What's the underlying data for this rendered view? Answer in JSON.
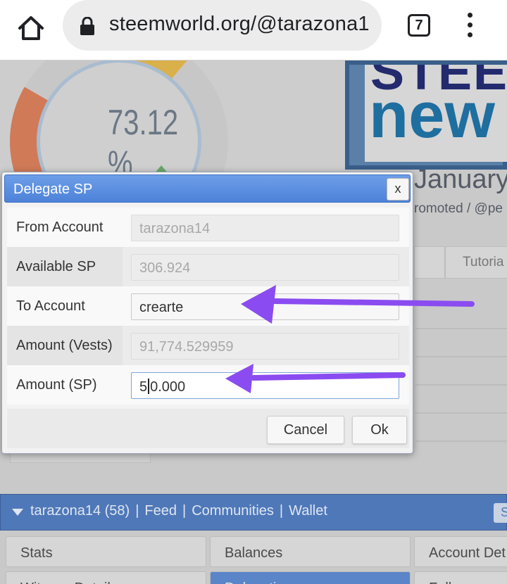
{
  "browser": {
    "url": "steemworld.org/@tarazona1",
    "tab_count": "7",
    "home_icon": "home-icon",
    "lock_icon": "lock-icon",
    "menu_icon": "more-vert-icon"
  },
  "background": {
    "gauge_value": "73.12 %",
    "banner_word_1": "STEE",
    "banner_word_2": "new",
    "banner_date": "January",
    "banner_promo": "romoted / @pe",
    "tutorial_tab": "Tutoria"
  },
  "nav": {
    "account": "tarazona14 (58)",
    "feed": "Feed",
    "communities": "Communities",
    "wallet": "Wallet",
    "sep": "|",
    "right_btn": "S",
    "buttons": {
      "stats": "Stats",
      "balances": "Balances",
      "account_details": "Account Det",
      "witness_details": "Witness Details",
      "delegations": "Delegations",
      "followers": "Followers"
    }
  },
  "dialog": {
    "title": "Delegate SP",
    "close_label": "x",
    "rows": [
      {
        "label": "From Account",
        "value": "tarazona14"
      },
      {
        "label": "Available SP",
        "value": "306.924"
      },
      {
        "label": "To Account",
        "value": "crearte"
      },
      {
        "label": "Amount (Vests)",
        "value": "91,774.529959"
      },
      {
        "label": "Amount (SP)",
        "value_before_caret": "5",
        "value_after_caret": "0.000"
      }
    ],
    "cancel_label": "Cancel",
    "ok_label": "Ok"
  },
  "colors": {
    "dialog_header": "#4d82d8",
    "annotation_arrow": "#8a4cf0"
  }
}
